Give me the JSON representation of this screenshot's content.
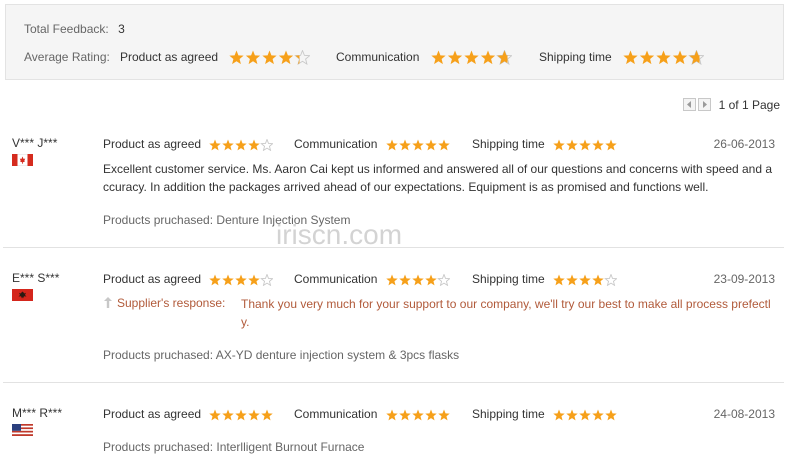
{
  "summary": {
    "total_label": "Total Feedback:",
    "total_value": "3",
    "avg_label": "Average Rating:",
    "ratings": [
      {
        "label": "Product as agreed",
        "stars": 4.3
      },
      {
        "label": "Communication",
        "stars": 4.7
      },
      {
        "label": "Shipping time",
        "stars": 4.7
      }
    ]
  },
  "pager": {
    "text": "1 of 1 Page",
    "prev_icon": "chevron-left-icon",
    "next_icon": "chevron-right-icon"
  },
  "reviews": [
    {
      "name": "V*** J***",
      "flag": "canada-flag",
      "ratings": [
        {
          "label": "Product as agreed",
          "stars": 4
        },
        {
          "label": "Communication",
          "stars": 5
        },
        {
          "label": "Shipping time",
          "stars": 5
        }
      ],
      "date": "26-06-2013",
      "comment": "Excellent customer service. Ms. Aaron Cai kept us informed and answered all of our questions and concerns with speed and accuracy. In addition the packages arrived ahead of our expectations. Equipment is as promised and functions well.",
      "products": "Products pruchased: Denture Injection System"
    },
    {
      "name": "E*** S***",
      "flag": "albania-flag",
      "ratings": [
        {
          "label": "Product as agreed",
          "stars": 4
        },
        {
          "label": "Communication",
          "stars": 4
        },
        {
          "label": "Shipping time",
          "stars": 4
        }
      ],
      "date": "23-09-2013",
      "supplier_label": "Supplier's response:",
      "supplier_response": "Thank you very much for your support to our company, we'll try our best to make all process prefectly.",
      "products": "Products pruchased: AX-YD denture injection system & 3pcs flasks"
    },
    {
      "name": "M*** R***",
      "flag": "usa-flag",
      "ratings": [
        {
          "label": "Product as agreed",
          "stars": 5
        },
        {
          "label": "Communication",
          "stars": 5
        },
        {
          "label": "Shipping time",
          "stars": 5
        }
      ],
      "date": "24-08-2013",
      "products": "Products pruchased: Interlligent Burnout Furnace"
    }
  ],
  "watermark": "iriscn.com",
  "colors": {
    "star_fill": "#f6a01a",
    "star_empty": "#c8c8c8",
    "response": "#b15a3a"
  }
}
